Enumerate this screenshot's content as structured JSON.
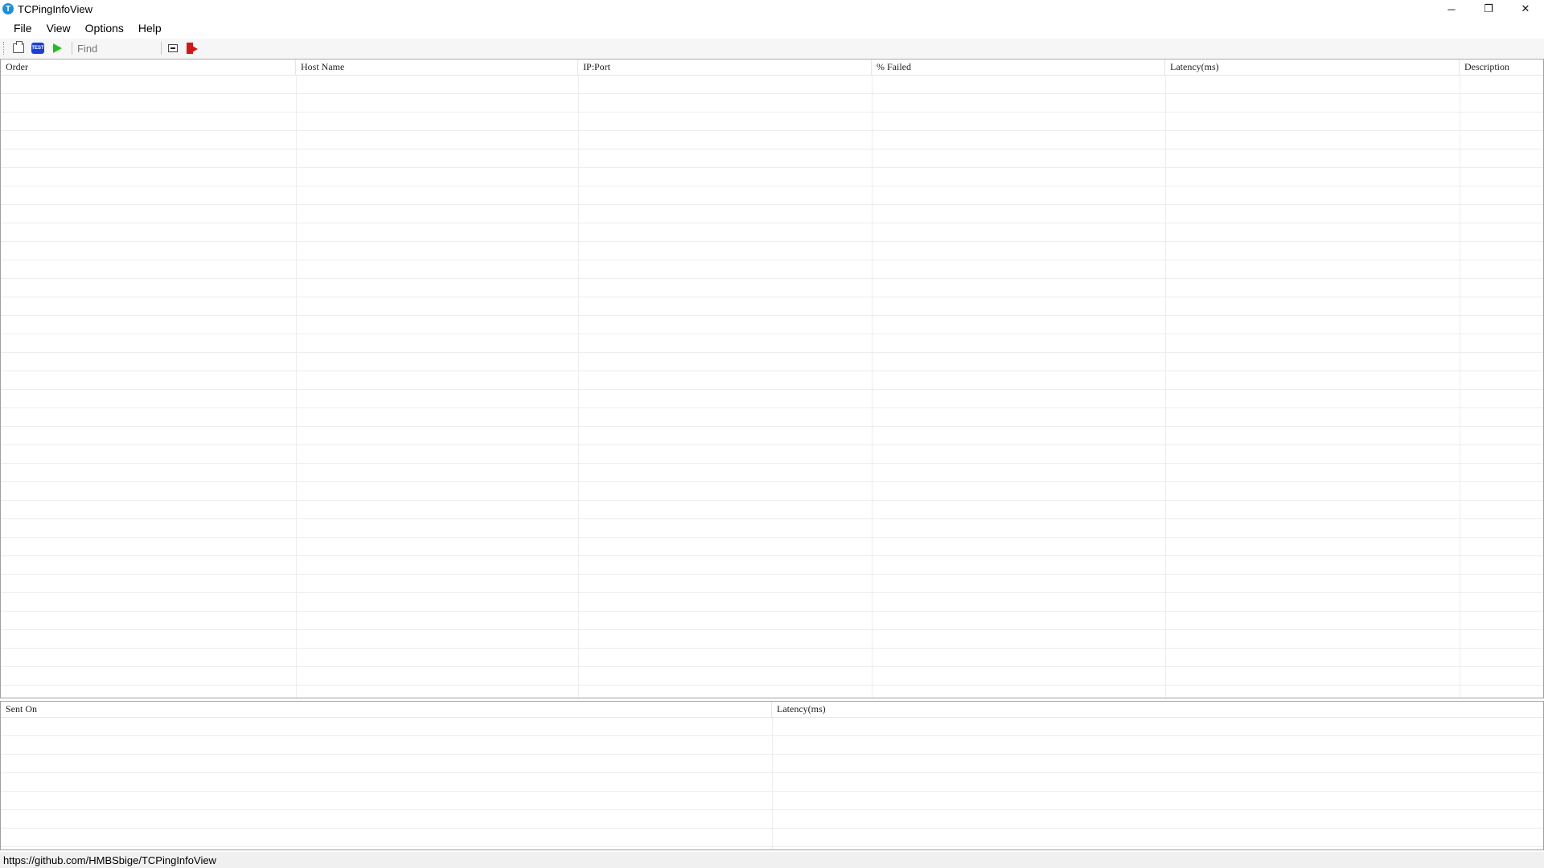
{
  "window": {
    "title": "TCPingInfoView",
    "app_icon_letter": "T",
    "controls": {
      "minimize": "─",
      "restore": "❐",
      "close": "✕"
    }
  },
  "menu": {
    "items": [
      "File",
      "View",
      "Options",
      "Help"
    ]
  },
  "toolbar": {
    "find_placeholder": "Find",
    "icons": [
      "open-file-icon",
      "test-icon",
      "start-play-icon",
      "minimize-box-icon",
      "exit-icon"
    ],
    "test_icon_text": "TEST"
  },
  "upper_table": {
    "columns": [
      "Order",
      "Host Name",
      "IP:Port",
      "% Failed",
      "Latency(ms)",
      "Description"
    ],
    "rows": []
  },
  "lower_table": {
    "columns": [
      "Sent On",
      "Latency(ms)"
    ],
    "rows": []
  },
  "statusbar": {
    "text": "https://github.com/HMBSbige/TCPingInfoView"
  },
  "colors": {
    "app_icon": "#1e90d6",
    "test_icon": "#1a3fd6",
    "play_icon": "#1fbf1f",
    "exit_icon": "#d01818"
  }
}
